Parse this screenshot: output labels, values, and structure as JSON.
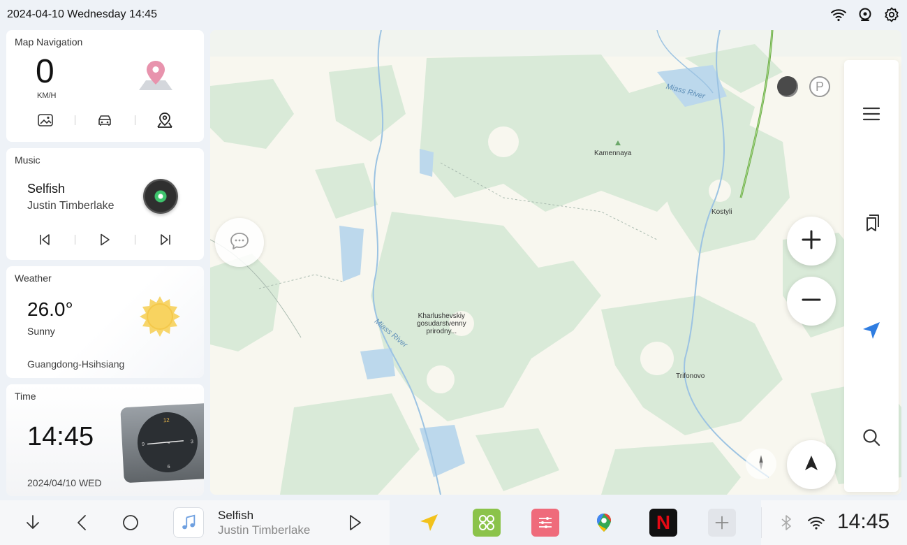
{
  "status": {
    "datetime": "2024-04-10 Wednesday 14:45",
    "icons": [
      "wifi-icon",
      "camera-icon",
      "settings-icon"
    ]
  },
  "nav_card": {
    "title": "Map Navigation",
    "speed": "0",
    "speed_unit": "KM/H",
    "actions": [
      "gallery-icon",
      "car-icon",
      "location-icon"
    ]
  },
  "music_card": {
    "title": "Music",
    "song": "Selfish",
    "artist": "Justin Timberlake",
    "controls": [
      "previous-icon",
      "play-icon",
      "next-icon"
    ]
  },
  "weather_card": {
    "title": "Weather",
    "temperature": "26.0°",
    "condition": "Sunny",
    "location": "Guangdong-Hsihsiang"
  },
  "time_card": {
    "title": "Time",
    "time": "14:45",
    "date": "2024/04/10 WED",
    "clock_numerals": {
      "top": "12",
      "left": "9",
      "right": "3",
      "bottom": "6"
    }
  },
  "map": {
    "labels": {
      "kamennaya": "Kamennaya",
      "kostyli": "Kostyli",
      "trifonovo": "Trifonovo",
      "reserve_line1": "Kharlushevskiy",
      "reserve_line2": "gosudarstvenny",
      "reserve_line3": "prirodny..."
    },
    "river_labels": {
      "top": "Miass River",
      "middle": "Miass River"
    },
    "parking_glyph": "P",
    "controls": [
      "chat-icon",
      "zoom-in-icon",
      "zoom-out-icon",
      "locate-arrow-icon",
      "compass-icon"
    ]
  },
  "side_panel": {
    "items": [
      "menu-icon",
      "bookmarks-icon",
      "navigate-icon",
      "search-icon"
    ]
  },
  "taskbar": {
    "song": "Selfish",
    "artist": "Justin Timberlake",
    "clock": "14:45",
    "apps": [
      "navigation-app",
      "apps-grid-app",
      "equalizer-app",
      "google-maps-app",
      "netflix-app",
      "add-app"
    ],
    "netflix_glyph": "N",
    "system_icons": [
      "bluetooth-icon",
      "wifi-icon"
    ]
  },
  "colors": {
    "accent_blue": "#2f7de1",
    "map_green": "#d9ead8",
    "map_water": "#bcd8ec",
    "apps_grid_bg": "#8bc34a",
    "equalizer_bg": "#ef6b7b",
    "netflix_bg": "#111111",
    "netflix_red": "#e50914"
  }
}
